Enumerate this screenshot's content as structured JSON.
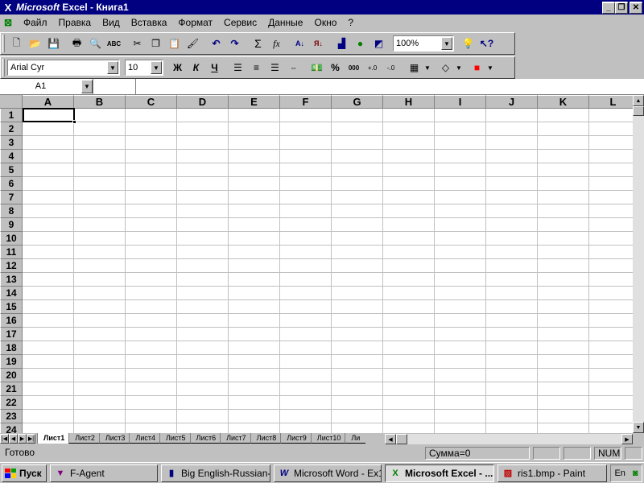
{
  "titlebar": {
    "brand": "Microsoft",
    "title": " Excel - Книга1"
  },
  "menu": [
    "Файл",
    "Правка",
    "Вид",
    "Вставка",
    "Формат",
    "Сервис",
    "Данные",
    "Окно",
    "?"
  ],
  "toolbar": {
    "zoom": "100%"
  },
  "format_toolbar": {
    "font": "Arial Cyr",
    "size": "10",
    "bold": "Ж",
    "italic": "К",
    "underline": "Ч",
    "percent": "%",
    "thousands": "000"
  },
  "formula_bar": {
    "name_box": "A1",
    "content": ""
  },
  "columns": [
    "A",
    "B",
    "C",
    "D",
    "E",
    "F",
    "G",
    "H",
    "I",
    "J",
    "K",
    "L"
  ],
  "rows": [
    "1",
    "2",
    "3",
    "4",
    "5",
    "6",
    "7",
    "8",
    "9",
    "10",
    "11",
    "12",
    "13",
    "14",
    "15",
    "16",
    "17",
    "18",
    "19",
    "20",
    "21",
    "22",
    "23",
    "24"
  ],
  "sheets": [
    "Лист1",
    "Лист2",
    "Лист3",
    "Лист4",
    "Лист5",
    "Лист6",
    "Лист7",
    "Лист8",
    "Лист9",
    "Лист10",
    "Ли"
  ],
  "status": {
    "ready": "Готово",
    "sum": "Сумма=0",
    "num": "NUM"
  },
  "taskbar": {
    "start": "Пуск",
    "items": [
      "F-Agent",
      "Big English-Russian-E...",
      "Microsoft Word - Ex1...",
      "Microsoft Excel - ...",
      "ris1.bmp - Paint"
    ],
    "lang": "En"
  },
  "colors": {
    "title": "#000080",
    "face": "#c0c0c0",
    "grid": "#c0c0c0"
  }
}
